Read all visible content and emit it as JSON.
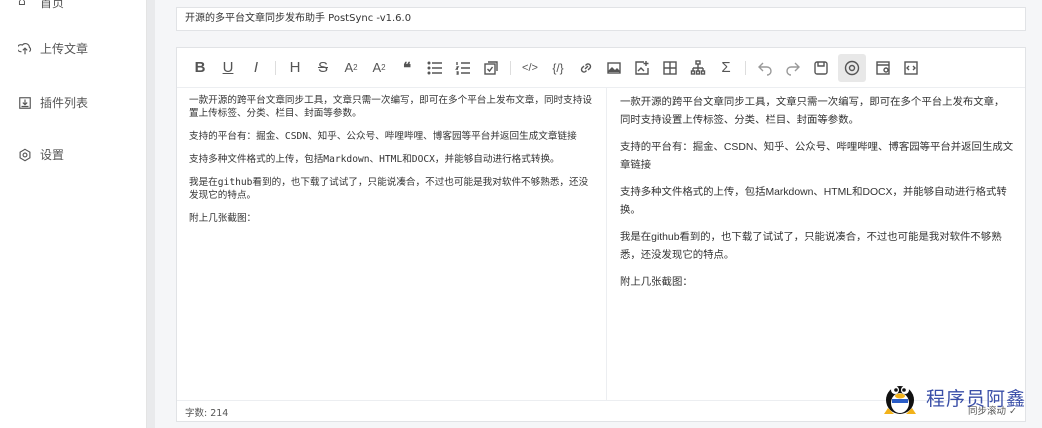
{
  "sidebar": {
    "cut_item": {
      "label": "首页"
    },
    "items": [
      {
        "label": "上传文章",
        "icon": "upload-icon"
      },
      {
        "label": "插件列表",
        "icon": "plugin-list-icon"
      },
      {
        "label": "设置",
        "icon": "settings-icon"
      }
    ]
  },
  "editor": {
    "title_value": "开源的多平台文章同步发布助手 PostSync -v1.6.0",
    "toolbar": [
      "bold",
      "underline",
      "italic",
      "heading",
      "strikethrough",
      "subscript",
      "superscript",
      "quote",
      "unordered-list",
      "ordered-list",
      "task",
      "code-inline",
      "code-block",
      "link",
      "image",
      "image-upload",
      "table",
      "mermaid",
      "katex",
      "undo",
      "redo",
      "save",
      "preview",
      "html-preview",
      "catalog"
    ],
    "source": [
      "一款开源的跨平台文章同步工具，文章只需一次编写，即可在多个平台上发布文章，同时支持设置上传标签、分类、栏目、封面等参数。",
      "支持的平台有：掘金、CSDN、知乎、公众号、哔哩哔哩、博客园等平台并返回生成文章链接",
      "支持多种文件格式的上传，包括Markdown、HTML和DOCX，并能够自动进行格式转换。",
      "我是在github看到的，也下载了试试了，只能说凑合，不过也可能是我对软件不够熟悉，还没发现它的特点。",
      "附上几张截图："
    ],
    "preview": [
      "一款开源的跨平台文章同步工具，文章只需一次编写，即可在多个平台上发布文章，同时支持设置上传标签、分类、栏目、封面等参数。",
      "支持的平台有：掘金、CSDN、知乎、公众号、哔哩哔哩、博客园等平台并返回生成文章链接",
      "支持多种文件格式的上传，包括Markdown、HTML和DOCX，并能够自动进行格式转换。",
      "我是在github看到的，也下载了试试了，只能说凑合，不过也可能是我对软件不够熟悉，还没发现它的特点。",
      "附上几张截图："
    ],
    "word_count": "字数: 214",
    "sync_scroll": "同步滚动 ✓"
  },
  "watermark": {
    "text": "程序员阿鑫"
  }
}
